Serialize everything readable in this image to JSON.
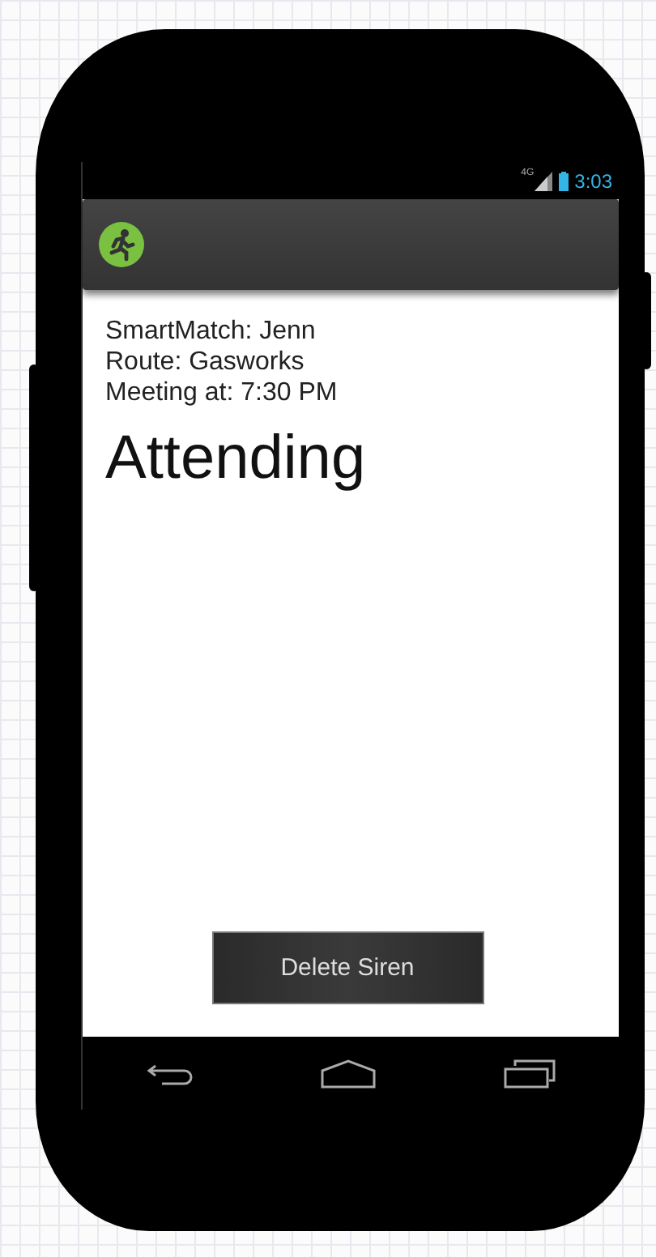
{
  "status_bar": {
    "network": "4G",
    "time": "3:03"
  },
  "details": [
    "SmartMatch: Jenn",
    "Route: Gasworks",
    "Meeting at: 7:30 PM"
  ],
  "status": "Attending",
  "button": "Delete Siren"
}
